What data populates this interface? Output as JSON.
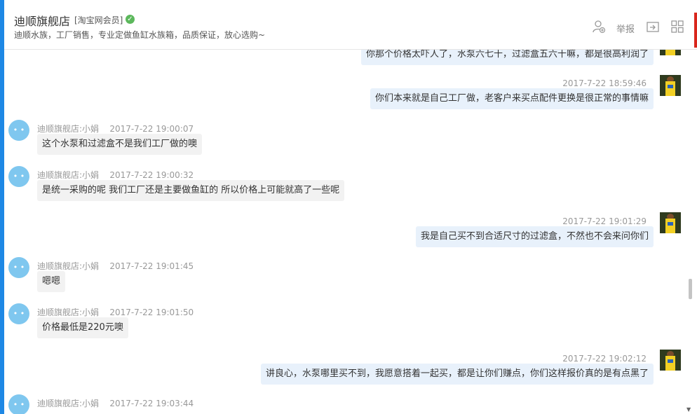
{
  "header": {
    "shop_name": "迪顺旗舰店",
    "member_tag": "[淘宝网会员]",
    "description": "迪顺水族，工厂销售，专业定做鱼缸水族箱，品质保证，放心选购~",
    "report_label": "举报",
    "icons": [
      "add-contact-icon",
      "share-icon",
      "apps-grid-icon"
    ],
    "verified_icon": "check-circle-icon"
  },
  "messages": [
    {
      "side": "out",
      "timestamp": "",
      "text": "你那个价格太吓人了，水泵六七十，过滤盒五六十嘛，都是很高利润了"
    },
    {
      "side": "out",
      "timestamp": "2017-7-22 18:59:46",
      "text": "你们本来就是自己工厂做，老客户来买点配件更换是很正常的事情嘛"
    },
    {
      "side": "in",
      "sender": "迪顺旗舰店:小娟",
      "timestamp": "2017-7-22 19:00:07",
      "text": "这个水泵和过滤盒不是我们工厂做的噢"
    },
    {
      "side": "in",
      "sender": "迪顺旗舰店:小娟",
      "timestamp": "2017-7-22 19:00:32",
      "text": "是统一采购的呢 我们工厂还是主要做鱼缸的 所以价格上可能就高了一些呢"
    },
    {
      "side": "out",
      "timestamp": "2017-7-22 19:01:29",
      "text": "我是自己买不到合适尺寸的过滤盒，不然也不会来问你们"
    },
    {
      "side": "in",
      "sender": "迪顺旗舰店:小娟",
      "timestamp": "2017-7-22 19:01:45",
      "text": "嗯嗯"
    },
    {
      "side": "in",
      "sender": "迪顺旗舰店:小娟",
      "timestamp": "2017-7-22 19:01:50",
      "text": "价格最低是220元噢"
    },
    {
      "side": "out",
      "timestamp": "2017-7-22 19:02:12",
      "text": "讲良心，水泵哪里买不到，我愿意搭着一起买，都是让你们赚点，你们这样报价真的是有点黑了"
    },
    {
      "side": "in",
      "sender": "迪顺旗舰店:小娟",
      "timestamp": "2017-7-22 19:03:44",
      "text": ""
    }
  ],
  "colors": {
    "accent": "#1e88e5",
    "incoming_bubble": "#f2f2f2",
    "outgoing_bubble": "#e8f1fb",
    "verified": "#5cb85c",
    "red_marker": "#d9261c"
  }
}
